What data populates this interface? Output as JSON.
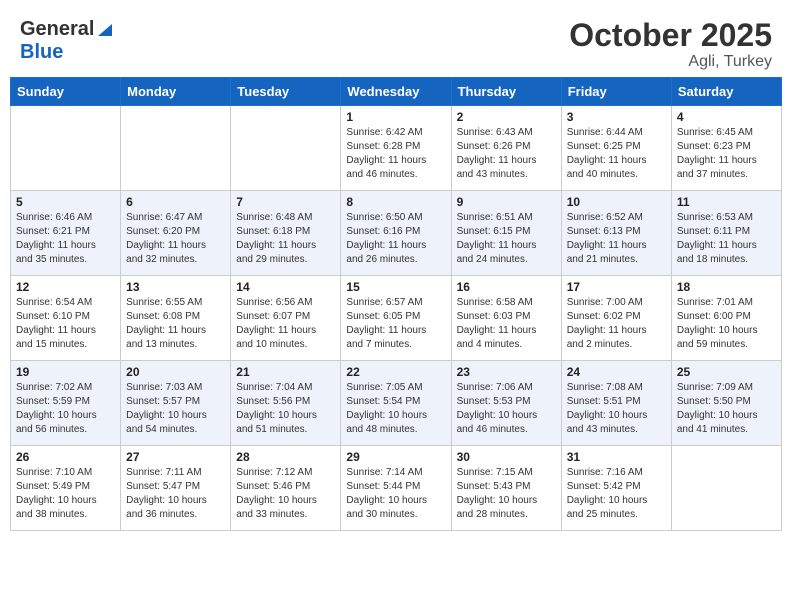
{
  "header": {
    "logo_general": "General",
    "logo_blue": "Blue",
    "month": "October 2025",
    "location": "Agli, Turkey"
  },
  "days_of_week": [
    "Sunday",
    "Monday",
    "Tuesday",
    "Wednesday",
    "Thursday",
    "Friday",
    "Saturday"
  ],
  "weeks": [
    [
      {
        "day": "",
        "info": ""
      },
      {
        "day": "",
        "info": ""
      },
      {
        "day": "",
        "info": ""
      },
      {
        "day": "1",
        "info": "Sunrise: 6:42 AM\nSunset: 6:28 PM\nDaylight: 11 hours\nand 46 minutes."
      },
      {
        "day": "2",
        "info": "Sunrise: 6:43 AM\nSunset: 6:26 PM\nDaylight: 11 hours\nand 43 minutes."
      },
      {
        "day": "3",
        "info": "Sunrise: 6:44 AM\nSunset: 6:25 PM\nDaylight: 11 hours\nand 40 minutes."
      },
      {
        "day": "4",
        "info": "Sunrise: 6:45 AM\nSunset: 6:23 PM\nDaylight: 11 hours\nand 37 minutes."
      }
    ],
    [
      {
        "day": "5",
        "info": "Sunrise: 6:46 AM\nSunset: 6:21 PM\nDaylight: 11 hours\nand 35 minutes."
      },
      {
        "day": "6",
        "info": "Sunrise: 6:47 AM\nSunset: 6:20 PM\nDaylight: 11 hours\nand 32 minutes."
      },
      {
        "day": "7",
        "info": "Sunrise: 6:48 AM\nSunset: 6:18 PM\nDaylight: 11 hours\nand 29 minutes."
      },
      {
        "day": "8",
        "info": "Sunrise: 6:50 AM\nSunset: 6:16 PM\nDaylight: 11 hours\nand 26 minutes."
      },
      {
        "day": "9",
        "info": "Sunrise: 6:51 AM\nSunset: 6:15 PM\nDaylight: 11 hours\nand 24 minutes."
      },
      {
        "day": "10",
        "info": "Sunrise: 6:52 AM\nSunset: 6:13 PM\nDaylight: 11 hours\nand 21 minutes."
      },
      {
        "day": "11",
        "info": "Sunrise: 6:53 AM\nSunset: 6:11 PM\nDaylight: 11 hours\nand 18 minutes."
      }
    ],
    [
      {
        "day": "12",
        "info": "Sunrise: 6:54 AM\nSunset: 6:10 PM\nDaylight: 11 hours\nand 15 minutes."
      },
      {
        "day": "13",
        "info": "Sunrise: 6:55 AM\nSunset: 6:08 PM\nDaylight: 11 hours\nand 13 minutes."
      },
      {
        "day": "14",
        "info": "Sunrise: 6:56 AM\nSunset: 6:07 PM\nDaylight: 11 hours\nand 10 minutes."
      },
      {
        "day": "15",
        "info": "Sunrise: 6:57 AM\nSunset: 6:05 PM\nDaylight: 11 hours\nand 7 minutes."
      },
      {
        "day": "16",
        "info": "Sunrise: 6:58 AM\nSunset: 6:03 PM\nDaylight: 11 hours\nand 4 minutes."
      },
      {
        "day": "17",
        "info": "Sunrise: 7:00 AM\nSunset: 6:02 PM\nDaylight: 11 hours\nand 2 minutes."
      },
      {
        "day": "18",
        "info": "Sunrise: 7:01 AM\nSunset: 6:00 PM\nDaylight: 10 hours\nand 59 minutes."
      }
    ],
    [
      {
        "day": "19",
        "info": "Sunrise: 7:02 AM\nSunset: 5:59 PM\nDaylight: 10 hours\nand 56 minutes."
      },
      {
        "day": "20",
        "info": "Sunrise: 7:03 AM\nSunset: 5:57 PM\nDaylight: 10 hours\nand 54 minutes."
      },
      {
        "day": "21",
        "info": "Sunrise: 7:04 AM\nSunset: 5:56 PM\nDaylight: 10 hours\nand 51 minutes."
      },
      {
        "day": "22",
        "info": "Sunrise: 7:05 AM\nSunset: 5:54 PM\nDaylight: 10 hours\nand 48 minutes."
      },
      {
        "day": "23",
        "info": "Sunrise: 7:06 AM\nSunset: 5:53 PM\nDaylight: 10 hours\nand 46 minutes."
      },
      {
        "day": "24",
        "info": "Sunrise: 7:08 AM\nSunset: 5:51 PM\nDaylight: 10 hours\nand 43 minutes."
      },
      {
        "day": "25",
        "info": "Sunrise: 7:09 AM\nSunset: 5:50 PM\nDaylight: 10 hours\nand 41 minutes."
      }
    ],
    [
      {
        "day": "26",
        "info": "Sunrise: 7:10 AM\nSunset: 5:49 PM\nDaylight: 10 hours\nand 38 minutes."
      },
      {
        "day": "27",
        "info": "Sunrise: 7:11 AM\nSunset: 5:47 PM\nDaylight: 10 hours\nand 36 minutes."
      },
      {
        "day": "28",
        "info": "Sunrise: 7:12 AM\nSunset: 5:46 PM\nDaylight: 10 hours\nand 33 minutes."
      },
      {
        "day": "29",
        "info": "Sunrise: 7:14 AM\nSunset: 5:44 PM\nDaylight: 10 hours\nand 30 minutes."
      },
      {
        "day": "30",
        "info": "Sunrise: 7:15 AM\nSunset: 5:43 PM\nDaylight: 10 hours\nand 28 minutes."
      },
      {
        "day": "31",
        "info": "Sunrise: 7:16 AM\nSunset: 5:42 PM\nDaylight: 10 hours\nand 25 minutes."
      },
      {
        "day": "",
        "info": ""
      }
    ]
  ]
}
